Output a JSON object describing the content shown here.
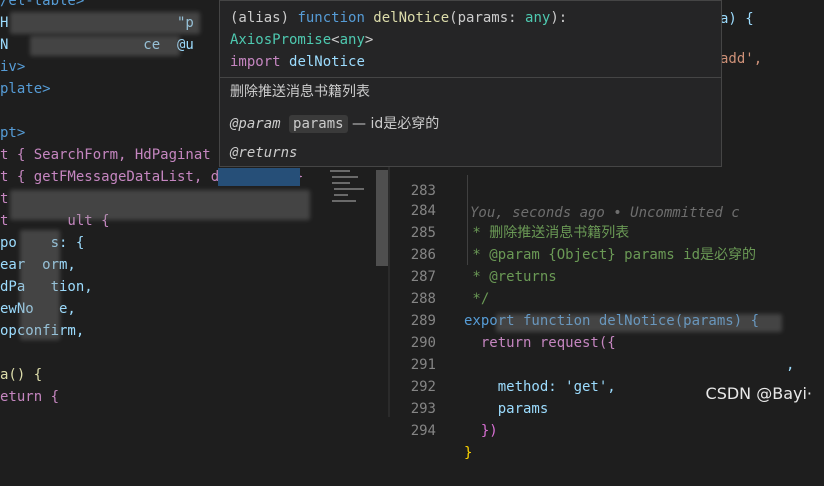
{
  "left_code": [
    {
      "txt": "/el-table>"
    },
    {
      "txt": "H                    \"p"
    },
    {
      "txt": "N                ce  @u"
    },
    {
      "txt": "iv>"
    },
    {
      "txt": "plate>"
    },
    {
      "txt": ""
    },
    {
      "txt": "pt>"
    },
    {
      "txt": "t { SearchForm, HdPaginat"
    },
    {
      "txt": "t { getFMessageDataList, delNotice }"
    },
    {
      "txt": "t"
    },
    {
      "txt": "t       ult {"
    },
    {
      "txt": "po    s: {"
    },
    {
      "txt": "ear  orm,"
    },
    {
      "txt": "dPa   tion,"
    },
    {
      "txt": "ewNo   e,"
    },
    {
      "txt": "opconfirm,"
    },
    {
      "txt": ""
    },
    {
      "txt": "a() {"
    },
    {
      "txt": "eturn {"
    }
  ],
  "hover": {
    "line1_alias": "(alias) ",
    "line1_kw": "function ",
    "line1_fn": "delNotice",
    "line1_rest": "(params: ",
    "line1_ty": "any",
    "line1_end": "):",
    "line2_ty": "AxiosPromise",
    "line2_lt": "<",
    "line2_any": "any",
    "line2_gt": ">",
    "line3_kw": "import ",
    "line3_id": "delNotice",
    "description": "删除推送消息书籍列表",
    "param_tag": "@param",
    "param_name": "params",
    "param_desc": " — id是必穿的",
    "returns_tag": "@returns"
  },
  "right_code": {
    "lines": [
      {
        "num": "283",
        "blame": "You, seconds ago • Uncommitted c"
      },
      {
        "num": "284",
        "text": " * 删除推送消息书籍列表"
      },
      {
        "num": "285",
        "text": " * @param {Object} params id是必穿的"
      },
      {
        "num": "286",
        "text": " * @returns"
      },
      {
        "num": "287",
        "text": " */"
      },
      {
        "num": "288",
        "text": "export function delNotice(params) {"
      },
      {
        "num": "289",
        "text": "  return request({"
      },
      {
        "num": "290",
        "text": ","
      },
      {
        "num": "291",
        "text": "    method: 'get',"
      },
      {
        "num": "292",
        "text": "    params"
      },
      {
        "num": "293",
        "text": "  })"
      },
      {
        "num": "294",
        "text": "}"
      }
    ],
    "top_fragment_1": "a) {",
    "top_fragment_2": "add',"
  },
  "watermark": "CSDN @Bayi·"
}
